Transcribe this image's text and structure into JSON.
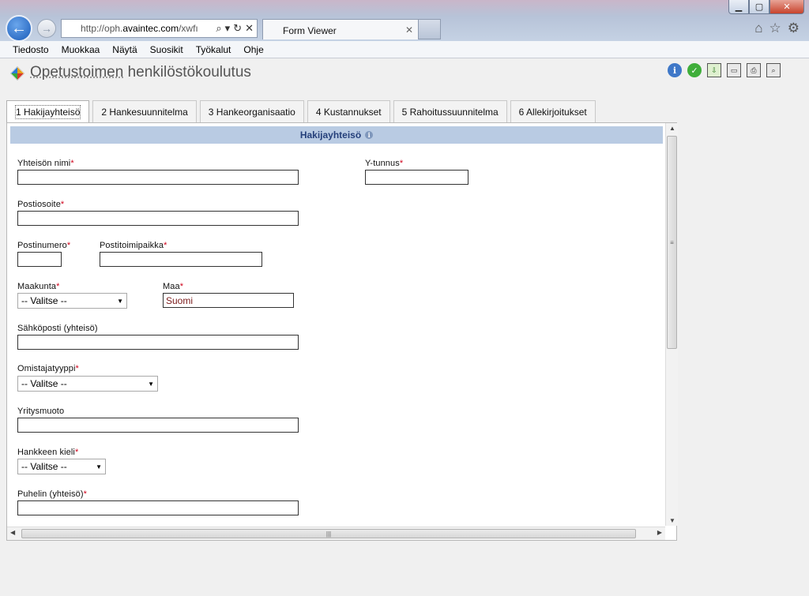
{
  "browser": {
    "url_prefix": "http://oph.",
    "url_domain": "avaintec.com",
    "url_suffix": "/xwfı",
    "tab_title": "Form Viewer",
    "menu": [
      "Tiedosto",
      "Muokkaa",
      "Näytä",
      "Suosikit",
      "Työkalut",
      "Ohje"
    ]
  },
  "app": {
    "title_first": "Opetustoimen",
    "title_rest": " henkilöstökoulutus"
  },
  "tabs": [
    {
      "label": "1 Hakijayhteisö"
    },
    {
      "label": "2 Hankesuunnitelma"
    },
    {
      "label": "3 Hankeorganisaatio"
    },
    {
      "label": "4 Kustannukset"
    },
    {
      "label": "5 Rahoitussuunnitelma"
    },
    {
      "label": "6 Allekirjoitukset"
    }
  ],
  "section": {
    "title": "Hakijayhteisö"
  },
  "form": {
    "yhteison_nimi": {
      "label": "Yhteisön nimi",
      "value": ""
    },
    "y_tunnus": {
      "label": "Y-tunnus",
      "value": ""
    },
    "postiosoite": {
      "label": "Postiosoite",
      "value": ""
    },
    "postinumero": {
      "label": "Postinumero",
      "value": ""
    },
    "postitoimipaikka": {
      "label": "Postitoimipaikka",
      "value": ""
    },
    "maakunta": {
      "label": "Maakunta",
      "selected": "-- Valitse --"
    },
    "maa": {
      "label": "Maa",
      "value": "Suomi"
    },
    "sahkoposti": {
      "label": "Sähköposti (yhteisö)",
      "value": ""
    },
    "omistajatyyppi": {
      "label": "Omistajatyyppi",
      "selected": "-- Valitse --"
    },
    "yritysmuoto": {
      "label": "Yritysmuoto",
      "value": ""
    },
    "hankkeen_kieli": {
      "label": "Hankkeen kieli",
      "selected": "-- Valitse --"
    },
    "puhelin": {
      "label": "Puhelin (yhteisö)",
      "value": ""
    },
    "required_mark": "*"
  },
  "icons": [
    "info-icon",
    "check-icon",
    "download-icon",
    "folder-icon",
    "print-icon",
    "print-preview-icon"
  ]
}
